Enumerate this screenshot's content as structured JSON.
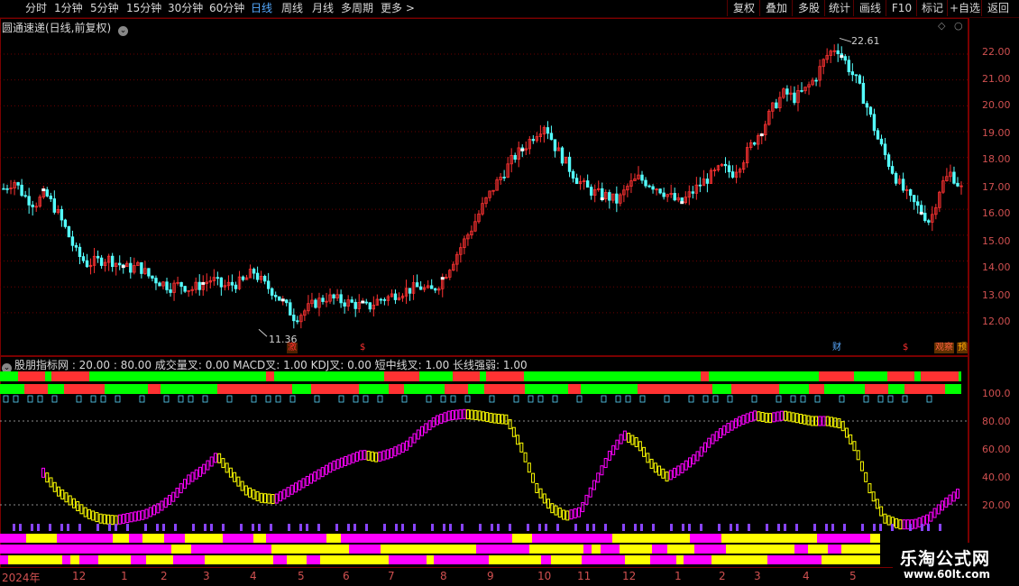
{
  "periods": [
    "分时",
    "1分钟",
    "5分钟",
    "15分钟",
    "30分钟",
    "60分钟",
    "日线",
    "周线",
    "月线",
    "多周期",
    "更多 >"
  ],
  "active_period": "日线",
  "right_buttons": [
    "复权",
    "叠加",
    "多股",
    "统计",
    "画线",
    "F10",
    "标记",
    "+自选",
    "返回"
  ],
  "main_title": "圆通速递(日线,前复权)",
  "y_ticks": [
    "22.00",
    "21.00",
    "20.00",
    "19.00",
    "18.00",
    "17.00",
    "16.00",
    "15.00",
    "14.00",
    "13.00",
    "12.00"
  ],
  "high_label": "22.61",
  "low_label": "11.36",
  "event_marks": [
    {
      "text": "激",
      "color": "#ff3030",
      "bg": "#502000"
    },
    {
      "text": "$",
      "color": "#ff3030",
      "bg": ""
    },
    {
      "text": "财",
      "color": "#5aaaff",
      "bg": ""
    },
    {
      "text": "$",
      "color": "#ff3030",
      "bg": ""
    },
    {
      "text": "观察",
      "color": "#ff6040",
      "bg": "#603000"
    },
    {
      "text": "预",
      "color": "#ffaa00",
      "bg": "#603000"
    }
  ],
  "indicator_title": "股朋指标网 : 20.00 : 80.00 成交量叉: 0.00 MACD叉: 1.00 KDJ叉: 0.00 短中线叉: 1.00 长线强弱: 1.00",
  "indicator_y_ticks": [
    "100.0",
    "80.00",
    "60.00",
    "40.00",
    "20.00"
  ],
  "x_labels": [
    "2024年",
    "12",
    "1",
    "2",
    "3",
    "4",
    "5",
    "6",
    "7",
    "8",
    "9",
    "10",
    "11",
    "12",
    "1",
    "2",
    "3",
    "4",
    "5"
  ],
  "watermark_main": "乐淘公式网",
  "watermark_url": "www.60lt.com",
  "colors": {
    "up": "#ff3232",
    "down": "#54ffff",
    "accent": "#55aaff",
    "magenta": "#ff00ff",
    "yellow": "#ffff00",
    "green": "#00ff00"
  },
  "chart_data": {
    "type": "candlestick",
    "y_range": [
      11.3,
      22.8
    ],
    "high": 22.61,
    "low": 11.36,
    "close_trend": [
      16.8,
      17.1,
      16.5,
      16.2,
      16.6,
      16.0,
      15.2,
      14.3,
      13.9,
      14.0,
      14.1,
      13.9,
      13.7,
      13.8,
      13.4,
      13.2,
      13.0,
      13.1,
      12.9,
      13.1,
      13.3,
      13.0,
      13.1,
      13.2,
      13.6,
      13.1,
      12.8,
      12.3,
      11.8,
      12.1,
      12.4,
      12.6,
      12.5,
      12.4,
      12.3,
      12.2,
      12.5,
      12.6,
      12.8,
      12.9,
      13.0,
      12.8,
      13.2,
      13.9,
      14.6,
      15.3,
      16.1,
      16.8,
      17.4,
      18.0,
      18.4,
      18.9,
      19.3,
      18.4,
      17.8,
      17.2,
      16.8,
      16.6,
      16.5,
      16.3,
      16.9,
      17.2,
      17.0,
      16.8,
      16.5,
      16.2,
      16.6,
      17.0,
      17.3,
      17.6,
      17.4,
      17.9,
      18.6,
      19.2,
      20.0,
      20.5,
      20.3,
      20.6,
      21.1,
      21.9,
      22.3,
      21.6,
      20.9,
      19.9,
      18.7,
      17.8,
      17.0,
      16.4,
      16.0,
      15.5,
      16.9,
      17.4,
      16.8
    ],
    "indicator_series": [
      {
        "name": "",
        "values": [
          43,
          30,
          22,
          14,
          10,
          9,
          11,
          13,
          18,
          26,
          38,
          45,
          55,
          42,
          30,
          25,
          24,
          30,
          36,
          42,
          48,
          52,
          56,
          54,
          57,
          62,
          72,
          80,
          84,
          85,
          84,
          82,
          81,
          60,
          32,
          18,
          12,
          15,
          35,
          55,
          70,
          64,
          48,
          40,
          46,
          54,
          66,
          74,
          80,
          84,
          82,
          84,
          82,
          80,
          80,
          78,
          60,
          30,
          10,
          6,
          6,
          10,
          20,
          28
        ]
      }
    ]
  }
}
